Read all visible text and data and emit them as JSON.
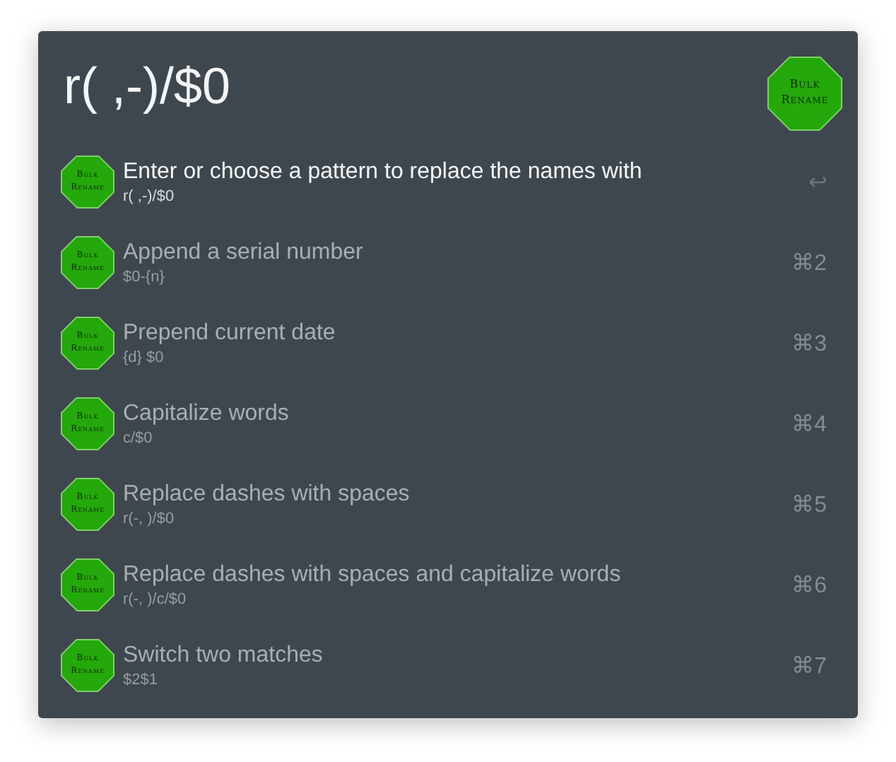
{
  "query": {
    "value": "r( ,-)/$0"
  },
  "logo": {
    "lines": [
      "Bulk",
      "Rename"
    ]
  },
  "results": [
    {
      "title": "Enter or choose a pattern to replace the names with",
      "subtitle": "r( ,-)/$0",
      "shortcut": "↩",
      "selected": true,
      "icon_lines": [
        "Bulk",
        "Rename"
      ]
    },
    {
      "title": "Append a serial number",
      "subtitle": "$0-{n}",
      "shortcut": "⌘2",
      "selected": false,
      "icon_lines": [
        "Bulk",
        "Rename"
      ]
    },
    {
      "title": "Prepend current date",
      "subtitle": "{d} $0",
      "shortcut": "⌘3",
      "selected": false,
      "icon_lines": [
        "Bulk",
        "Rename"
      ]
    },
    {
      "title": "Capitalize words",
      "subtitle": "c/$0",
      "shortcut": "⌘4",
      "selected": false,
      "icon_lines": [
        "Bulk",
        "Rename"
      ]
    },
    {
      "title": "Replace dashes with spaces",
      "subtitle": "r(-, )/$0",
      "shortcut": "⌘5",
      "selected": false,
      "icon_lines": [
        "Bulk",
        "Rename"
      ]
    },
    {
      "title": "Replace dashes with spaces and capitalize words",
      "subtitle": "r(-, )/c/$0",
      "shortcut": "⌘6",
      "selected": false,
      "icon_lines": [
        "Bulk",
        "Rename"
      ]
    },
    {
      "title": "Switch two matches",
      "subtitle": "$2$1",
      "shortcut": "⌘7",
      "selected": false,
      "icon_lines": [
        "Bulk",
        "Rename"
      ]
    }
  ]
}
